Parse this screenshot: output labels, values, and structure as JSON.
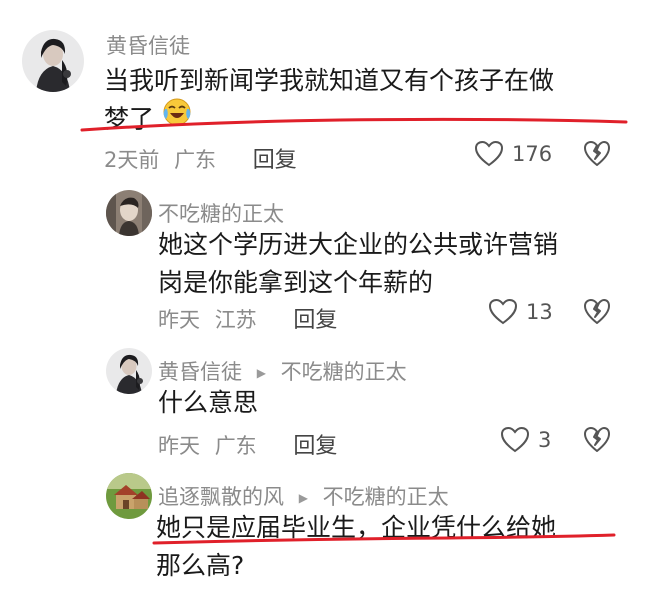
{
  "comments": [
    {
      "user": "黄昏信徒",
      "text_line1": "当我听到新闻学我就知道又有个孩子在做",
      "text_line2": "梦了",
      "emoji": "crying-laughing-emoji",
      "time": "2天前",
      "location": "广东",
      "reply_label": "回复",
      "likes": "176"
    },
    {
      "user": "不吃糖的正太",
      "text_line1": "她这个学历进大企业的公共或许营销",
      "text_line2": "岗是你能拿到这个年薪的",
      "time": "昨天",
      "location": "江苏",
      "reply_label": "回复",
      "likes": "13"
    },
    {
      "user": "黄昏信徒",
      "reply_to": "不吃糖的正太",
      "text_line1": "什么意思",
      "time": "昨天",
      "location": "广东",
      "reply_label": "回复",
      "likes": "3"
    },
    {
      "user": "追逐飘散的风",
      "reply_to": "不吃糖的正太",
      "text_line1": "她只是应届毕业生，企业凭什么给她",
      "text_line2": "那么高?"
    }
  ],
  "colors": {
    "underline": "#e0202a",
    "meta": "#8b8b8b",
    "text": "#1a1a1a"
  }
}
